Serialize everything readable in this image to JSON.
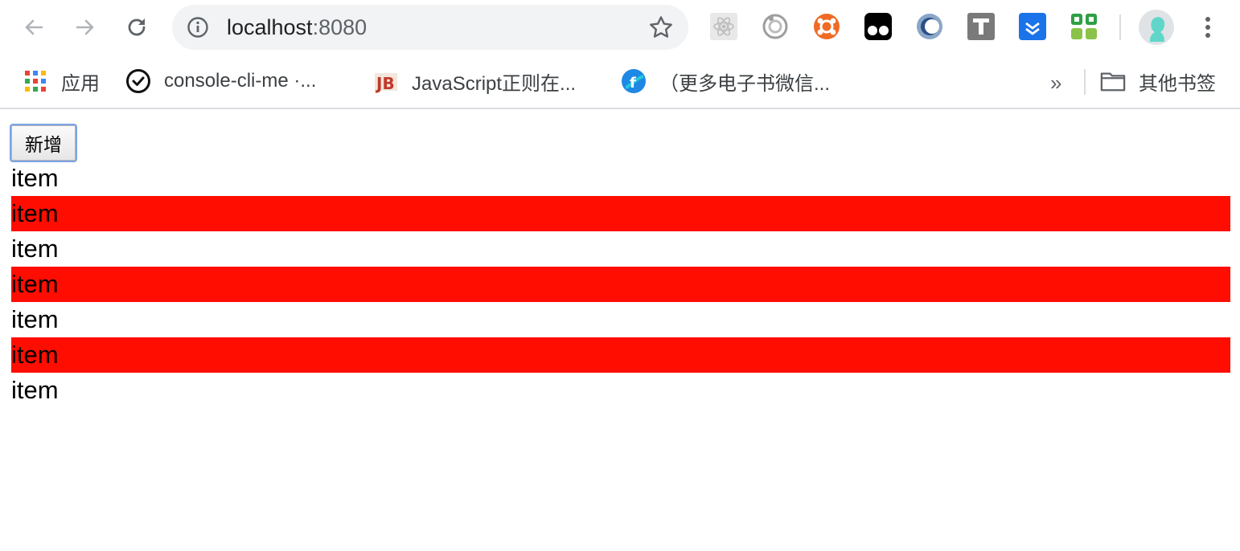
{
  "browser": {
    "url_host": "localhost",
    "url_port": ":8080"
  },
  "extensions": [
    {
      "icon": "react-devtools-icon"
    },
    {
      "icon": "eye-target-icon"
    },
    {
      "icon": "ubuntu-icon"
    },
    {
      "icon": "tampermonkey-icon"
    },
    {
      "icon": "crescent-icon"
    },
    {
      "icon": "t-icon"
    },
    {
      "icon": "download-icon"
    },
    {
      "icon": "grid-icon"
    }
  ],
  "bookmarks": {
    "apps_label": "应用",
    "items": [
      {
        "label": "console-cli-me ·...",
        "icon": "check-circle-icon"
      },
      {
        "label": "JavaScript正则在...",
        "icon": "jb-icon"
      },
      {
        "label": "（更多电子书微信...",
        "icon": "f-logo-icon"
      }
    ],
    "more_label": "»",
    "other_label": "其他书签"
  },
  "page": {
    "add_button": "新增",
    "items": [
      {
        "text": "item",
        "highlighted": false
      },
      {
        "text": "item",
        "highlighted": true
      },
      {
        "text": "item",
        "highlighted": false
      },
      {
        "text": "item",
        "highlighted": true
      },
      {
        "text": "item",
        "highlighted": false
      },
      {
        "text": "item",
        "highlighted": true
      },
      {
        "text": "item",
        "highlighted": false
      }
    ],
    "highlight_color": "#ff0d00"
  }
}
